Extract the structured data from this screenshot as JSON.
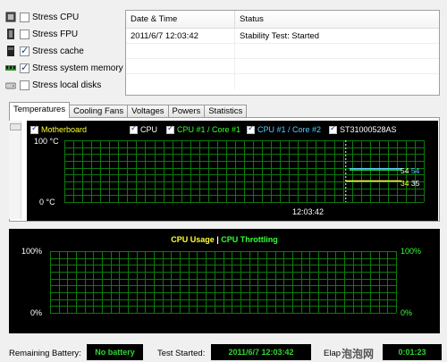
{
  "stress": [
    {
      "label": "Stress CPU",
      "checked": false,
      "icon": "cpu-icon"
    },
    {
      "label": "Stress FPU",
      "checked": false,
      "icon": "fpu-icon"
    },
    {
      "label": "Stress cache",
      "checked": true,
      "icon": "cache-icon"
    },
    {
      "label": "Stress system memory",
      "checked": true,
      "icon": "memory-icon"
    },
    {
      "label": "Stress local disks",
      "checked": false,
      "icon": "disk-icon"
    }
  ],
  "log": {
    "headers": {
      "date": "Date & Time",
      "status": "Status"
    },
    "rows": [
      {
        "date": "2011/6/7 12:03:42",
        "status": "Stability Test: Started"
      }
    ]
  },
  "tabs": [
    "Temperatures",
    "Cooling Fans",
    "Voltages",
    "Powers",
    "Statistics"
  ],
  "temp_chart": {
    "legend": [
      {
        "label": "Motherboard",
        "checked": true,
        "color": "#ffff33"
      },
      {
        "label": "CPU",
        "checked": true,
        "color": "#ffffff"
      },
      {
        "label": "CPU #1 / Core #1",
        "checked": true,
        "color": "#33ff33"
      },
      {
        "label": "CPU #1 / Core #2",
        "checked": true,
        "color": "#55ccff"
      },
      {
        "label": "ST31000528AS",
        "checked": true,
        "color": "#ffffff"
      }
    ],
    "y_top": "100 °C",
    "y_bottom": "0 °C",
    "x_label": "12:03:42",
    "values": [
      {
        "text": "54",
        "color": "#ffffff"
      },
      {
        "text": "54",
        "color": "#55ccff"
      },
      {
        "text": "34",
        "color": "#ffff33"
      },
      {
        "text": "35",
        "color": "#ffffff"
      }
    ],
    "levels": {
      "core": 54,
      "motherboard": 34,
      "start_fraction": 0.783
    },
    "grid_color": "#0e7a0e"
  },
  "usage_chart": {
    "title_usage": "CPU Usage",
    "separator": "|",
    "title_throttle": "CPU Throttling",
    "usage_color": "#ffff33",
    "throttle_color": "#33ff33",
    "left_top": "100%",
    "left_bottom": "0%",
    "right_top": "100%",
    "right_bottom": "0%",
    "grid_color": "#0e7a0e"
  },
  "status": {
    "battery_label": "Remaining Battery:",
    "battery_value": "No battery",
    "started_label": "Test Started:",
    "started_value": "2011/6/7 12:03:42",
    "elapsed_label": "Elap",
    "elapsed_value": "0:01:23",
    "watermark": "泡泡网"
  }
}
